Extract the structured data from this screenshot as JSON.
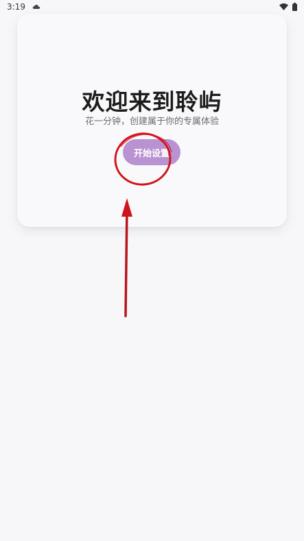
{
  "status_bar": {
    "time": "3:19",
    "notification_icon": "cloud-icon",
    "wifi_icon": "wifi-icon",
    "battery_icon": "battery-icon"
  },
  "welcome": {
    "title": "欢迎来到聆屿",
    "subtitle": "花一分钟，创建属于你的专属体验",
    "start_button_label": "开始设置"
  },
  "colors": {
    "background": "#f7f7fa",
    "card": "#f9f9fb",
    "button": "#b992d1",
    "annotation": "#d0141b"
  }
}
